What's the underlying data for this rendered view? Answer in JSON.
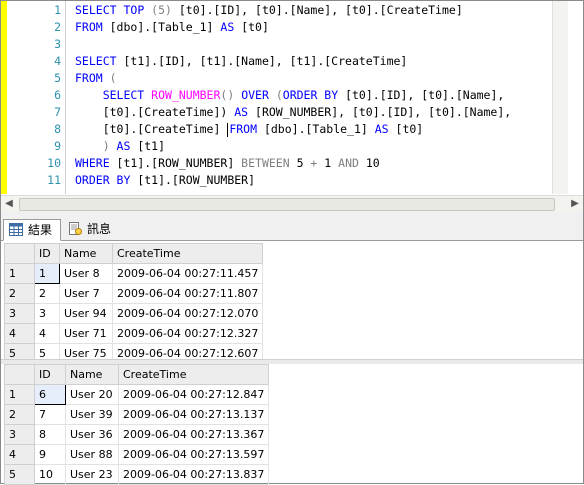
{
  "editor": {
    "lines": [
      {
        "n": "1",
        "segs": [
          {
            "t": "SELECT ",
            "c": "kw"
          },
          {
            "t": "TOP ",
            "c": "kw"
          },
          {
            "t": "(5) ",
            "c": "op"
          },
          {
            "t": "[t0].[ID], [t0].[Name], [t0].[CreateTime]",
            "c": ""
          }
        ]
      },
      {
        "n": "2",
        "segs": [
          {
            "t": "FROM ",
            "c": "kw"
          },
          {
            "t": "[dbo].[Table_1] ",
            "c": ""
          },
          {
            "t": "AS ",
            "c": "kw"
          },
          {
            "t": "[t0]",
            "c": ""
          }
        ]
      },
      {
        "n": "3",
        "segs": []
      },
      {
        "n": "4",
        "segs": [
          {
            "t": "SELECT ",
            "c": "kw"
          },
          {
            "t": "[t1].[ID], [t1].[Name], [t1].[CreateTime]",
            "c": ""
          }
        ]
      },
      {
        "n": "5",
        "segs": [
          {
            "t": "FROM ",
            "c": "kw"
          },
          {
            "t": "(",
            "c": "op"
          }
        ]
      },
      {
        "n": "6",
        "segs": [
          {
            "t": "    SELECT ",
            "c": "kw"
          },
          {
            "t": "ROW_NUMBER",
            "c": "fn"
          },
          {
            "t": "() ",
            "c": "op"
          },
          {
            "t": "OVER ",
            "c": "kw"
          },
          {
            "t": "(",
            "c": "op"
          },
          {
            "t": "ORDER BY ",
            "c": "kw"
          },
          {
            "t": "[t0].[ID], [t0].[Name],",
            "c": ""
          }
        ]
      },
      {
        "n": "7",
        "segs": [
          {
            "t": "    [t0].[CreateTime]) ",
            "c": ""
          },
          {
            "t": "AS ",
            "c": "kw"
          },
          {
            "t": "[ROW_NUMBER], [t0].[ID], [t0].[Name],",
            "c": ""
          }
        ]
      },
      {
        "n": "8",
        "segs": [
          {
            "t": "    [t0].[CreateTime] ",
            "c": ""
          },
          {
            "t": "CARET",
            "c": "caret"
          },
          {
            "t": "FROM ",
            "c": "kw"
          },
          {
            "t": "[dbo].[Table_1] ",
            "c": ""
          },
          {
            "t": "AS ",
            "c": "kw"
          },
          {
            "t": "[t0]",
            "c": ""
          }
        ]
      },
      {
        "n": "9",
        "segs": [
          {
            "t": "    ) ",
            "c": "op"
          },
          {
            "t": "AS ",
            "c": "kw"
          },
          {
            "t": "[t1]",
            "c": ""
          }
        ]
      },
      {
        "n": "10",
        "segs": [
          {
            "t": "WHERE ",
            "c": "kw"
          },
          {
            "t": "[t1].[ROW_NUMBER] ",
            "c": ""
          },
          {
            "t": "BETWEEN ",
            "c": "op"
          },
          {
            "t": "5 ",
            "c": ""
          },
          {
            "t": "+ ",
            "c": "op"
          },
          {
            "t": "1 ",
            "c": ""
          },
          {
            "t": "AND ",
            "c": "op"
          },
          {
            "t": "10",
            "c": ""
          }
        ]
      },
      {
        "n": "11",
        "segs": [
          {
            "t": "ORDER BY ",
            "c": "kw"
          },
          {
            "t": "[t1].[ROW_NUMBER]",
            "c": ""
          }
        ]
      }
    ]
  },
  "tabs": {
    "results_label": "結果",
    "messages_label": "訊息"
  },
  "grid1": {
    "headers": [
      "",
      "ID",
      "Name",
      "CreateTime"
    ],
    "rows": [
      [
        "1",
        "1",
        "User 8",
        "2009-06-04 00:27:11.457"
      ],
      [
        "2",
        "2",
        "User 7",
        "2009-06-04 00:27:11.807"
      ],
      [
        "3",
        "3",
        "User 94",
        "2009-06-04 00:27:12.070"
      ],
      [
        "4",
        "4",
        "User 71",
        "2009-06-04 00:27:12.327"
      ],
      [
        "5",
        "5",
        "User 75",
        "2009-06-04 00:27:12.607"
      ]
    ]
  },
  "grid2": {
    "headers": [
      "",
      "ID",
      "Name",
      "CreateTime"
    ],
    "rows": [
      [
        "1",
        "6",
        "User 20",
        "2009-06-04 00:27:12.847"
      ],
      [
        "2",
        "7",
        "User 39",
        "2009-06-04 00:27:13.137"
      ],
      [
        "3",
        "8",
        "User 36",
        "2009-06-04 00:27:13.367"
      ],
      [
        "4",
        "9",
        "User 88",
        "2009-06-04 00:27:13.597"
      ],
      [
        "5",
        "10",
        "User 23",
        "2009-06-04 00:27:13.837"
      ]
    ]
  }
}
